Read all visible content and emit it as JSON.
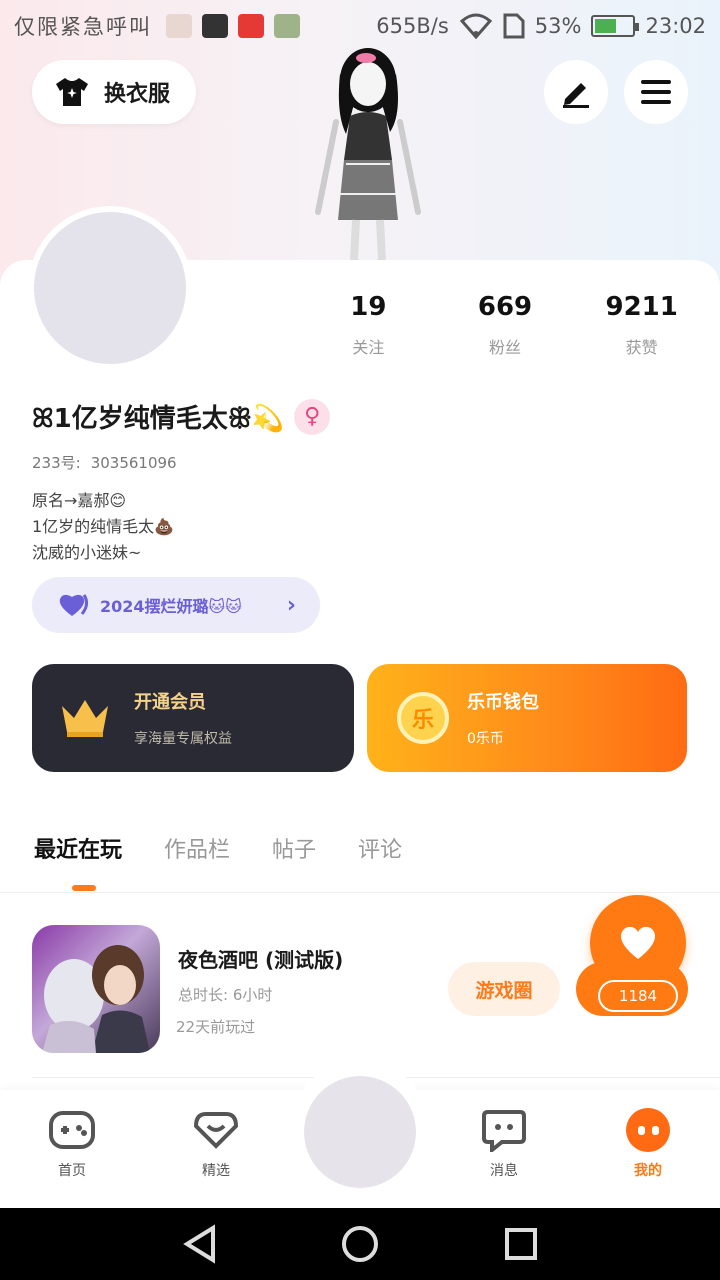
{
  "status_bar": {
    "carrier": "仅限紧急呼叫",
    "speed": "655B/s",
    "battery_percent": "53%",
    "time": "23:02"
  },
  "header": {
    "outfit_label": "换衣服"
  },
  "profile": {
    "stats": [
      {
        "value": "19",
        "label": "关注"
      },
      {
        "value": "669",
        "label": "粉丝"
      },
      {
        "value": "9211",
        "label": "获赞"
      }
    ],
    "nickname": "ꕤ1亿岁纯情毛太ꕥ💫",
    "gender_symbol": "♀",
    "uid_label": "233号:",
    "uid_value": "303561096",
    "bio_lines": [
      "原名→嘉郝😊",
      "1亿岁的纯情毛太💩",
      "沈威的小迷妹~"
    ],
    "tag": "2024摆烂妍璐🐱🐱"
  },
  "cards": {
    "vip_title": "开通会员",
    "vip_sub": "享海量专属权益",
    "wallet_title": "乐币钱包",
    "wallet_sub": "0乐币",
    "coin_symbol": "乐"
  },
  "tabs": [
    "最近在玩",
    "作品栏",
    "帖子",
    "评论"
  ],
  "game": {
    "title": "夜色酒吧 (测试版)",
    "duration": "总时长: 6小时",
    "last_played": "22天前玩过",
    "circle_button": "游戏圈",
    "like_count": "1184"
  },
  "bottom_nav": [
    {
      "label": "首页",
      "icon": "gamepad-icon"
    },
    {
      "label": "精选",
      "icon": "heart-diamond-icon"
    },
    {
      "label": "消息",
      "icon": "chat-bubble-icon"
    },
    {
      "label": "我的",
      "icon": "me-icon"
    }
  ],
  "colors": {
    "accent": "#ff7a12",
    "tag_purple": "#6a5fd6",
    "vip_dark": "#2a2a35"
  }
}
